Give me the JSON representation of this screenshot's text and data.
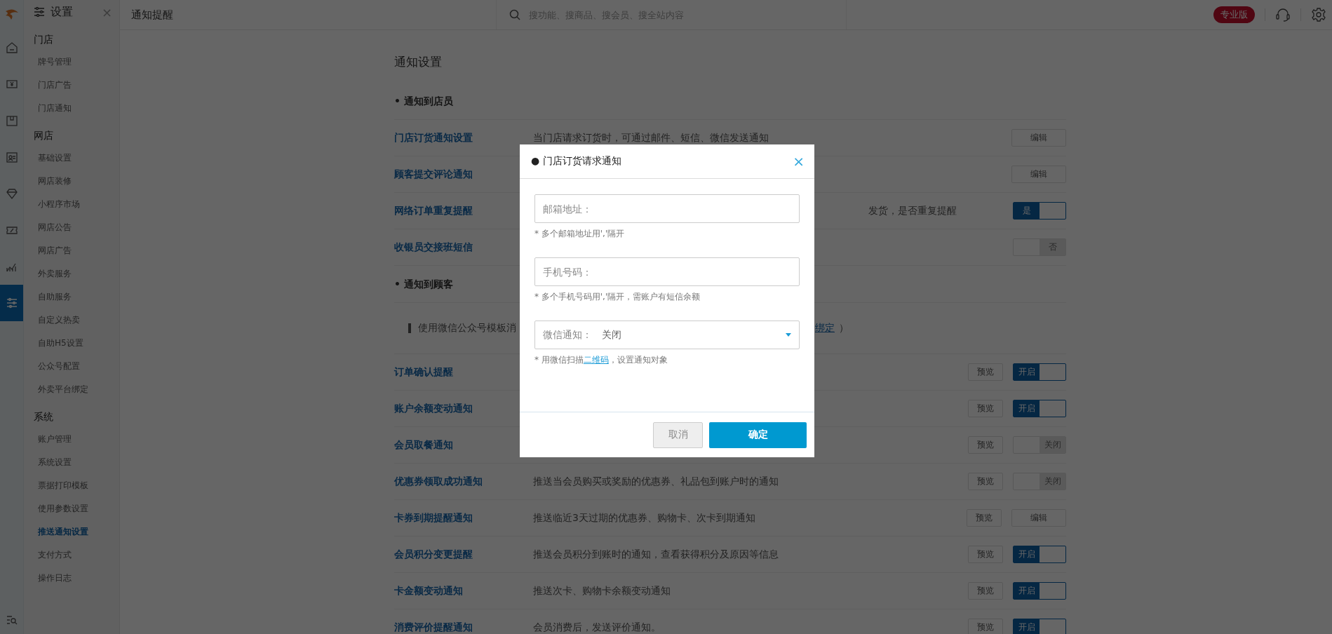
{
  "topbar": {
    "sidebar_title": "设置",
    "close": "×",
    "breadcrumb": "通知提醒",
    "search": {
      "placeholder": "搜功能、搜商品、搜会员、搜全站内容"
    },
    "badge": "专业版"
  },
  "rail": [
    {
      "selected": false
    },
    {
      "selected": false
    },
    {
      "selected": false
    },
    {
      "selected": false
    },
    {
      "selected": false
    },
    {
      "selected": false
    },
    {
      "selected": false
    },
    {
      "selected": true
    }
  ],
  "sidebar": {
    "groups": [
      {
        "title": "门店",
        "items": [
          {
            "label": "牌号管理",
            "selected": false
          },
          {
            "label": "门店广告",
            "selected": false
          },
          {
            "label": "门店通知",
            "selected": false
          }
        ]
      },
      {
        "title": "网店",
        "items": [
          {
            "label": "基础设置",
            "selected": false
          },
          {
            "label": "网店装修",
            "selected": false
          },
          {
            "label": "小程序市场",
            "selected": false
          },
          {
            "label": "网店公告",
            "selected": false
          },
          {
            "label": "网店广告",
            "selected": false
          },
          {
            "label": "外卖服务",
            "selected": false
          },
          {
            "label": "自助服务",
            "selected": false
          },
          {
            "label": "自定义热卖",
            "selected": false
          },
          {
            "label": "自助H5设置",
            "selected": false
          },
          {
            "label": "公众号配置",
            "selected": false
          },
          {
            "label": "外卖平台绑定",
            "selected": false
          }
        ]
      },
      {
        "title": "系统",
        "items": [
          {
            "label": "账户管理",
            "selected": false
          },
          {
            "label": "系统设置",
            "selected": false
          },
          {
            "label": "票据打印模板",
            "selected": false
          },
          {
            "label": "使用参数设置",
            "selected": false
          },
          {
            "label": "推送通知设置",
            "selected": true
          },
          {
            "label": "支付方式",
            "selected": false
          },
          {
            "label": "操作日志",
            "selected": false
          }
        ]
      }
    ]
  },
  "main": {
    "title": "通知设置",
    "blocks": [
      {
        "kind": "section",
        "title": "• 通知到店员"
      },
      {
        "kind": "row",
        "label": "门店订货通知设置",
        "desc": "当门店请求订货时，可通过邮件、短信、微信发送通知",
        "actions": [
          {
            "kind": "edit",
            "label": "编辑"
          }
        ]
      },
      {
        "kind": "row",
        "label": "顾客提交评论通知",
        "actions": [
          {
            "kind": "edit",
            "label": "编辑"
          }
        ]
      },
      {
        "kind": "row",
        "label": "网络订单重复提醒",
        "desc": "发货，是否重复提醒",
        "clipped": true,
        "actions": [
          {
            "kind": "toggle",
            "label": "是",
            "on": true
          }
        ]
      },
      {
        "kind": "row",
        "label": "收银员交接班短信",
        "actions": [
          {
            "kind": "toggle",
            "label": "否",
            "on": false
          }
        ]
      },
      {
        "kind": "section",
        "title": "• 通知到顾客"
      },
      {
        "kind": "notice",
        "text": "使用微信公众号模板消",
        "link": "绑定",
        "tail": "）"
      },
      {
        "kind": "row",
        "label": "订单确认提醒",
        "actions": [
          {
            "kind": "preview",
            "label": "预览"
          },
          {
            "kind": "toggle",
            "label": "开启",
            "on": true
          }
        ]
      },
      {
        "kind": "row",
        "label": "账户余额变动通知",
        "actions": [
          {
            "kind": "preview",
            "label": "预览"
          },
          {
            "kind": "toggle",
            "label": "开启",
            "on": true
          }
        ]
      },
      {
        "kind": "row",
        "label": "会员取餐通知",
        "actions": [
          {
            "kind": "preview",
            "label": "预览"
          },
          {
            "kind": "toggle",
            "label": "关闭",
            "on": false
          }
        ]
      },
      {
        "kind": "row",
        "label": "优惠券领取成功通知",
        "desc": "推送当会员购买或奖励的优惠券、礼品包到账户时的通知",
        "actions": [
          {
            "kind": "preview",
            "label": "预览"
          },
          {
            "kind": "toggle",
            "label": "关闭",
            "on": false
          }
        ]
      },
      {
        "kind": "row",
        "label": "卡券到期提醒通知",
        "desc": "推送临近3天过期的优惠券、购物卡、次卡到期通知",
        "actions": [
          {
            "kind": "preview",
            "label": "预览"
          },
          {
            "kind": "edit",
            "label": "编辑"
          }
        ]
      },
      {
        "kind": "row",
        "label": "会员积分变更提醒",
        "desc": "推送会员积分到账时的通知，查看获得积分及原因等信息",
        "actions": [
          {
            "kind": "preview",
            "label": "预览"
          },
          {
            "kind": "toggle",
            "label": "开启",
            "on": true
          }
        ]
      },
      {
        "kind": "row",
        "label": "卡金额变动通知",
        "desc": "推送次卡、购物卡余额变动通知",
        "actions": [
          {
            "kind": "preview",
            "label": "预览"
          },
          {
            "kind": "toggle",
            "label": "开启",
            "on": true
          }
        ]
      },
      {
        "kind": "row",
        "label": "消费评价提醒通知",
        "desc": "会员消费后，发送评价通知。",
        "actions": [
          {
            "kind": "preview",
            "label": "预览"
          },
          {
            "kind": "toggle",
            "label": "开启",
            "on": true
          }
        ]
      }
    ]
  },
  "dialog": {
    "title": "● 门店订货请求通知",
    "close": "×",
    "email": {
      "placeholder": "邮箱地址：",
      "hint": "* 多个邮箱地址用','隔开"
    },
    "phone": {
      "placeholder": "手机号码：",
      "hint": "* 多个手机号码用','隔开，需账户有短信余额"
    },
    "wechat": {
      "label": "微信通知：",
      "value": "关闭",
      "hint_before": "* 用微信扫描",
      "hint_link": "二维码",
      "hint_after": "，设置通知对象"
    },
    "buttons": [
      {
        "kind": "cancel",
        "label": "取消"
      },
      {
        "kind": "confirm",
        "label": "确定"
      }
    ]
  }
}
